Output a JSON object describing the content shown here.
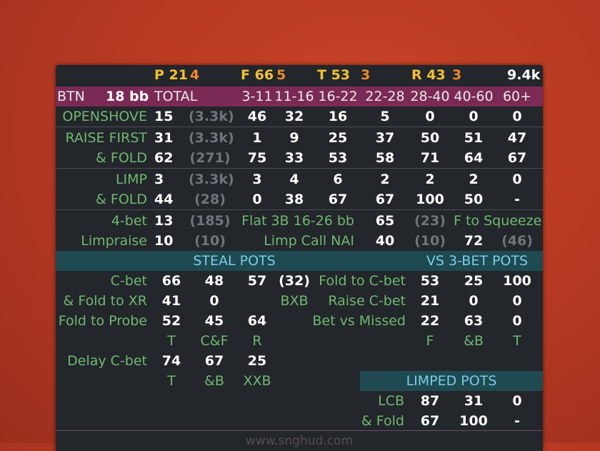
{
  "header": {
    "p_label": "P 21",
    "p_val": "4",
    "f_label": "F 66",
    "f_val": "5",
    "t_label": "T 53",
    "t_val": "3",
    "r_label": "R 43",
    "r_val": "3",
    "hands": "9.4k"
  },
  "position_row": {
    "position": "BTN",
    "stack": "18 bb",
    "total": "TOTAL",
    "ranges": [
      "3-11",
      "11-16",
      "16-22",
      "22-28",
      "28-40",
      "40-60",
      "60+"
    ]
  },
  "rows": {
    "openshove": {
      "label": "OPENSHOVE",
      "total": "15",
      "count": "(3.3k)",
      "vals": [
        "46",
        "32",
        "16",
        "5",
        "0",
        "0",
        "0"
      ]
    },
    "raise_first": {
      "label": "RAISE FIRST",
      "total": "31",
      "count": "(3.3k)",
      "vals": [
        "1",
        "9",
        "25",
        "37",
        "50",
        "51",
        "47"
      ]
    },
    "raise_fold": {
      "label": "& FOLD",
      "total": "62",
      "count": "(271)",
      "vals": [
        "75",
        "33",
        "53",
        "58",
        "71",
        "64",
        "67"
      ]
    },
    "limp": {
      "label": "LIMP",
      "total": "3",
      "count": "(3.3k)",
      "vals": [
        "3",
        "4",
        "6",
        "2",
        "2",
        "2",
        "0"
      ]
    },
    "limp_fold": {
      "label": "& FOLD",
      "total": "44",
      "count": "(28)",
      "vals": [
        "0",
        "38",
        "67",
        "67",
        "100",
        "50",
        "-"
      ]
    }
  },
  "misc": {
    "fourbet": {
      "label": "4-bet",
      "val": "13",
      "count": "(185)"
    },
    "flat3b": {
      "label": "Flat 3B 16-26 bb",
      "val": "65",
      "count": "(23)"
    },
    "ftosqueeze": {
      "label": "F to Squeeze"
    },
    "limpraise": {
      "label": "Limpraise",
      "val": "10",
      "count": "(10)"
    },
    "limpcall": {
      "label": "Limp Call NAI",
      "val": "40",
      "count": "(10)"
    },
    "squeeze_val": "72",
    "squeeze_count": "(46)"
  },
  "steal": {
    "title": "STEAL POTS",
    "cbet": {
      "label": "C-bet",
      "vals": [
        "66",
        "48",
        "57"
      ],
      "count": "(32)"
    },
    "fold_xr": {
      "label": "& Fold to XR",
      "vals": [
        "41",
        "0"
      ]
    },
    "bxb": "BXB",
    "fold_probe": {
      "label": "Fold to Probe",
      "vals": [
        "52",
        "45",
        "64"
      ]
    },
    "sub1": [
      "T",
      "C&F",
      "R"
    ],
    "delay_cbet": {
      "label": "Delay C-bet",
      "vals": [
        "74",
        "67",
        "25"
      ]
    },
    "sub2": [
      "T",
      "&B",
      "XXB"
    ]
  },
  "vs3bet": {
    "title": "VS 3-BET POTS",
    "fold_cbet": {
      "label": "Fold to C-bet",
      "vals": [
        "53",
        "25",
        "100"
      ]
    },
    "raise_cbet": {
      "label": "Raise C-bet",
      "vals": [
        "21",
        "0",
        "0"
      ]
    },
    "bet_missed": {
      "label": "Bet vs Missed",
      "vals": [
        "22",
        "63",
        "0"
      ]
    },
    "sub": [
      "F",
      "&B",
      "T"
    ]
  },
  "limped": {
    "title": "LIMPED POTS",
    "lcb": {
      "label": "LCB",
      "vals": [
        "87",
        "31",
        "0"
      ]
    },
    "fold": {
      "label": "& Fold",
      "vals": [
        "67",
        "100",
        "-"
      ]
    }
  },
  "watermark": "www.snghud.com",
  "colors": {
    "background": "#b93a22",
    "panel": "#23262b",
    "position_bar": "#7a2a55",
    "section_bar": "#1f4a52",
    "label_green": "#6fb870",
    "stat_white": "#ffffff",
    "sample_gray": "#71757b",
    "header_yellow": "#f2c233",
    "header_orange": "#f08a2a"
  }
}
